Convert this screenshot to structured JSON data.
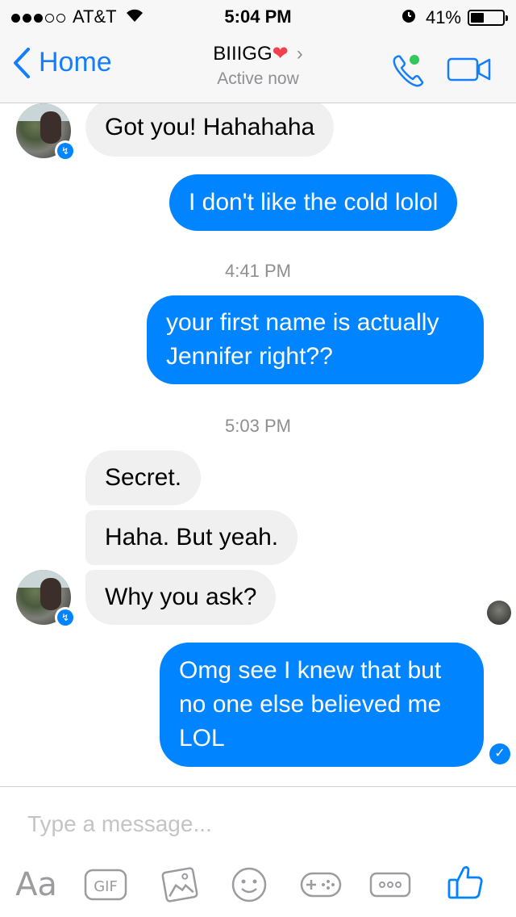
{
  "status": {
    "carrier": "AT&T",
    "time": "5:04 PM",
    "battery": "41%",
    "battery_level": 0.41,
    "signal_bars": 3
  },
  "header": {
    "back_label": "Home",
    "name": "BIIIGG",
    "heart": "❤",
    "status": "Active now"
  },
  "messages": {
    "m1": "Got you! Hahahaha",
    "m2": "I don't like the cold lolol",
    "t1": "4:41 PM",
    "m3_line1": "your first name is actually",
    "m3_line2": "Jennifer right??",
    "t2": "5:03 PM",
    "m4": "Secret.",
    "m5": "Haha. But yeah.",
    "m6": "Why you ask?",
    "m7_line1": "Omg see I knew that but",
    "m7_line2": "no one else believed me",
    "m7_line3": "LOL"
  },
  "composer": {
    "placeholder": "Type a message...",
    "aa": "Aa",
    "gif": "GIF"
  },
  "colors": {
    "accent": "#0084ff",
    "link": "#147efb",
    "incoming": "#f1f0f0",
    "online": "#34c759",
    "heart": "#f2414d"
  },
  "icons": [
    "wifi-icon",
    "alarm-icon",
    "battery-icon",
    "back-chevron-icon",
    "phone-icon",
    "video-icon",
    "messenger-badge-icon",
    "photo-icon",
    "emoji-icon",
    "game-icon",
    "more-icon",
    "thumbs-up-icon"
  ]
}
